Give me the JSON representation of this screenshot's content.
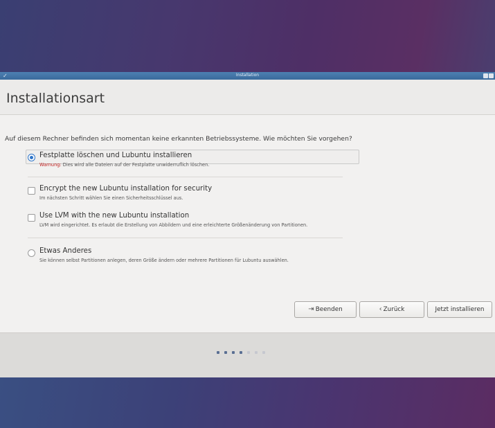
{
  "window": {
    "title": "Installation"
  },
  "header": {
    "title": "Installationsart"
  },
  "question": "Auf diesem Rechner befinden sich momentan keine erkannten Betriebssysteme. Wie möchten Sie vorgehen?",
  "options": [
    {
      "label": "Festplatte löschen und Lubuntu installieren",
      "warning_prefix": "Warnung:",
      "description": "Dies wird alle Dateien auf der Festplatte unwiderruflich löschen.",
      "type": "radio",
      "checked": true
    },
    {
      "label": "Encrypt the new Lubuntu installation for security",
      "description": "Im nächsten Schritt wählen Sie einen Sicherheitsschlüssel aus.",
      "type": "checkbox",
      "checked": false
    },
    {
      "label": "Use LVM with the new Lubuntu installation",
      "description": "LVM wird eingerichtet. Es erlaubt die Erstellung von Abbildern und eine erleichterte Größenänderung von Partitionen.",
      "type": "checkbox",
      "checked": false
    },
    {
      "label": "Etwas Anderes",
      "description": "Sie können selbst Partitionen anlegen, deren Größe ändern oder mehrere Partitionen für Lubuntu auswählen.",
      "type": "radio",
      "checked": false
    }
  ],
  "buttons": {
    "quit": "Beenden",
    "back": "Zurück",
    "install": "Jetzt installieren"
  },
  "progress": {
    "total_steps": 7,
    "completed_steps": 4
  },
  "colors": {
    "accent": "#2d74c8",
    "warning": "#c0201f",
    "titlebar": "#4d80b2"
  }
}
